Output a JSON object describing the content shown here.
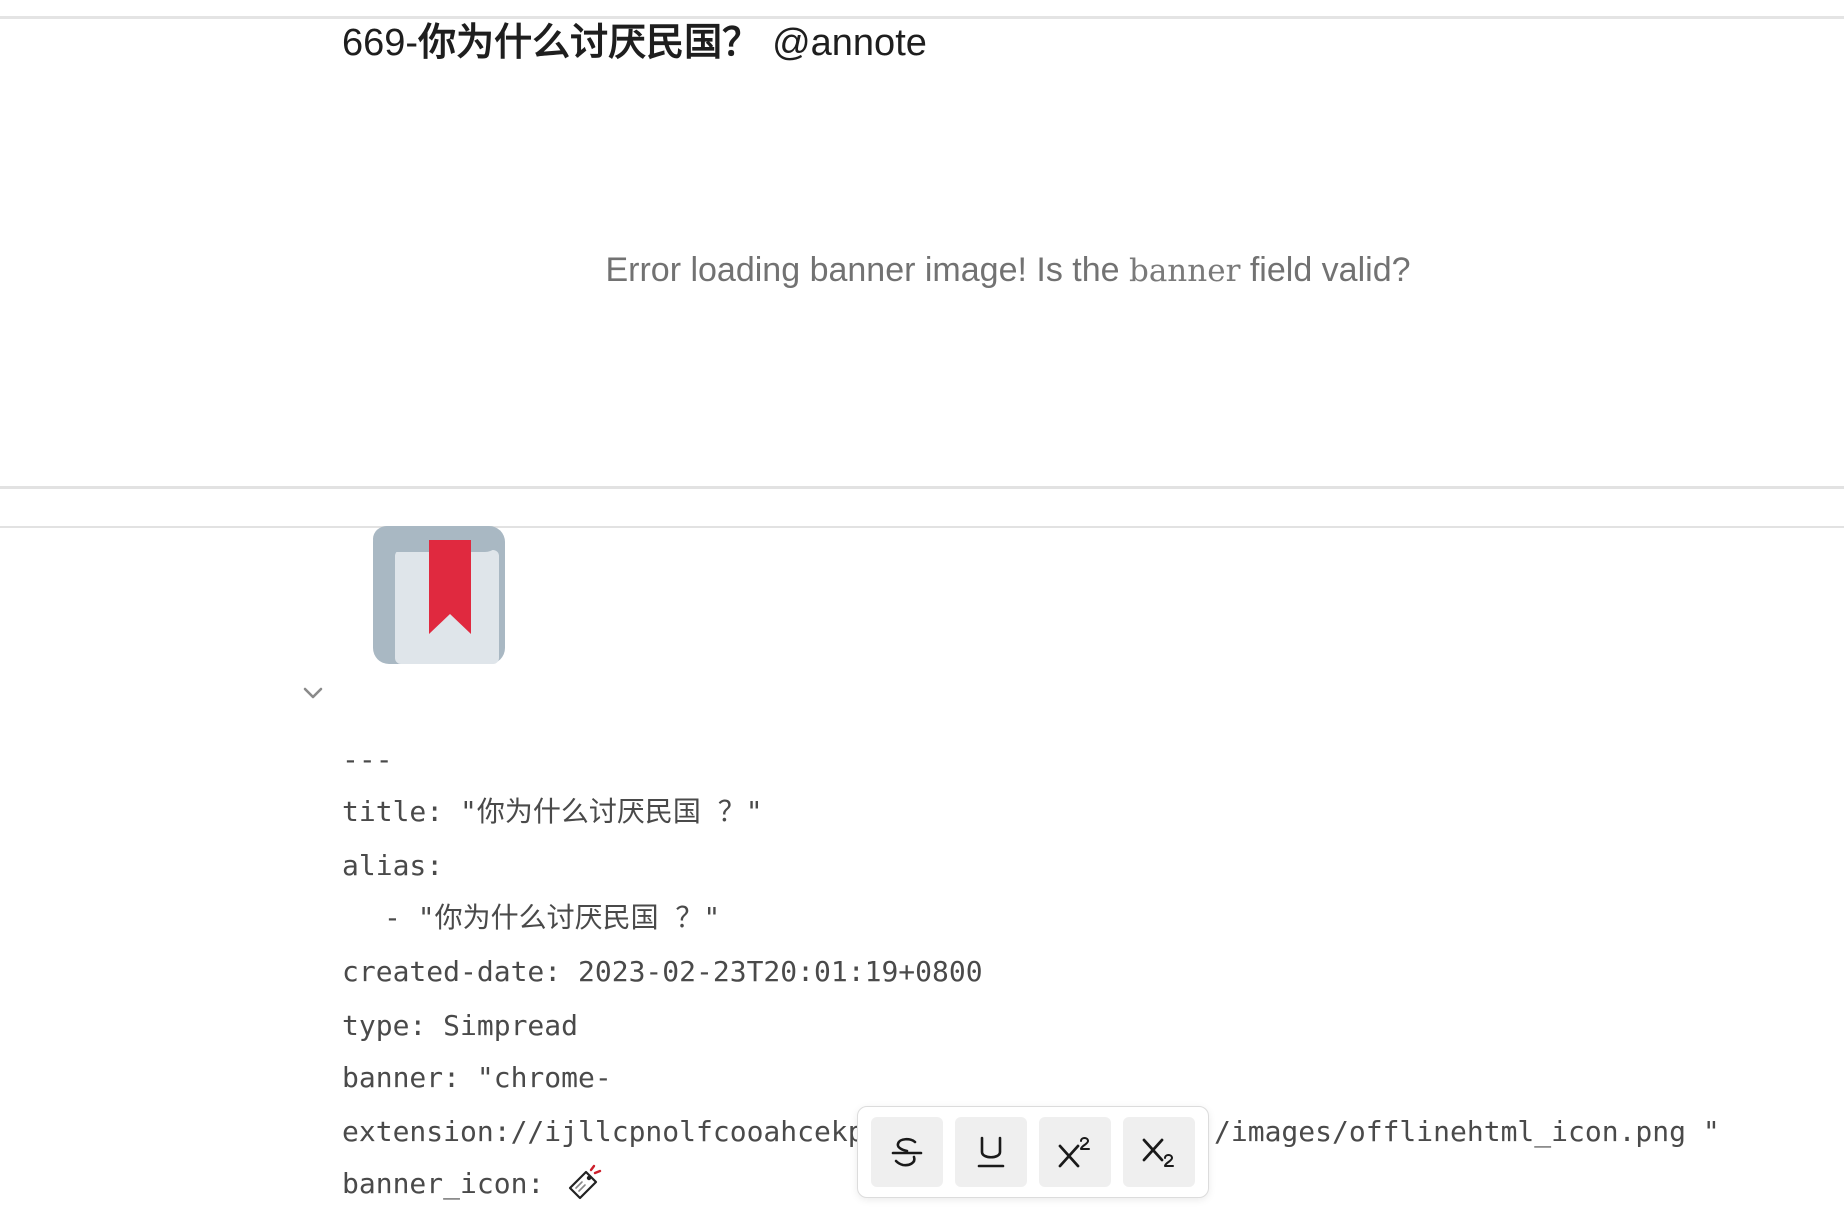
{
  "note": {
    "title_number": "669-",
    "title_text": "你为什么讨厌民国？",
    "title_tag": "@annote"
  },
  "banner": {
    "error_prefix": "Error loading banner image! Is the ",
    "error_code": "banner",
    "error_suffix": " field valid?"
  },
  "banner_icon": {
    "icon": "bookmark-book-icon",
    "colors": {
      "book_cover": "#a9b8c3",
      "book_pages": "#dfe5ea",
      "ribbon": "#e0293f"
    }
  },
  "fold_toggle": {
    "icon": "chevron-down-icon"
  },
  "frontmatter": {
    "lines": [
      "---",
      "title: \"你为什么讨厌民国 ？\"",
      "alias:",
      "- \"你为什么讨厌民国 ？\"",
      "created-date: 2023-02-23T20:01:19+0800",
      "type: Simpread",
      "banner: \"chrome-",
      "extension://ijllcpnolfcooahcekp",
      "/images/offlinehtml_icon.png \"",
      "banner_icon:"
    ],
    "banner_icon_value": "bookmark-tag-emoji-icon"
  },
  "format_toolbar": {
    "buttons": [
      {
        "name": "strikethrough",
        "icon": "strikethrough-icon"
      },
      {
        "name": "underline",
        "icon": "underline-icon"
      },
      {
        "name": "superscript",
        "icon": "superscript-icon"
      },
      {
        "name": "subscript",
        "icon": "subscript-icon"
      }
    ]
  }
}
